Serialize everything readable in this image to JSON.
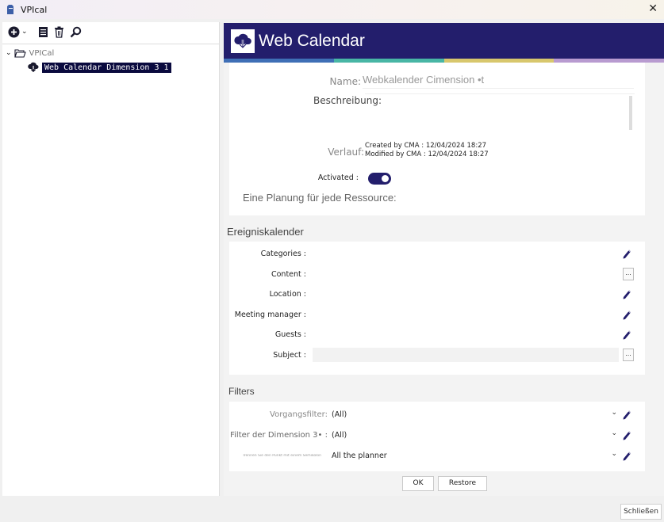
{
  "window": {
    "title": "VPIcal",
    "close_glyph": "✕"
  },
  "toolbar": {
    "add_chevron": "⌄"
  },
  "tree": {
    "root_label": "VPICal",
    "child_label": "Web Calendar Dimension 3 1",
    "root_expander": "⌄"
  },
  "header": {
    "title": "Web Calendar",
    "stripe_colors": [
      "#3f6fb6",
      "#48b6a5",
      "#d8c76d",
      "#b89bd0"
    ]
  },
  "general": {
    "name_label": "Name:",
    "name_value": "Webkalender Cimension •t",
    "description_label": "Beschreibung:",
    "history_label": "Verlauf:",
    "created": "Created by CMA : 12/04/2024 18:27",
    "modified": "Modified by  CMA : 12/04/2024 18:27",
    "activated_label": "Activated :",
    "planning_label": "Eine Planung für jede Ressource:"
  },
  "events": {
    "section_title": "Ereigniskalender",
    "rows": [
      {
        "label": "Categories :",
        "action": "edit"
      },
      {
        "label": "Content :",
        "action": "dots"
      },
      {
        "label": "Location :",
        "action": "edit"
      },
      {
        "label": "Meeting manager :",
        "action": "edit"
      },
      {
        "label": "Guests :",
        "action": "edit"
      },
      {
        "label": "Subject :",
        "action": "dots"
      }
    ],
    "dots_glyph": "..."
  },
  "filters": {
    "section_title": "Filters",
    "rows": [
      {
        "label": "Vorgangsfilter:",
        "value": "(All)"
      },
      {
        "label": "Filter der Dimension 3• :",
        "value": "(All)"
      },
      {
        "label": "Trennen Sie den Punkt mit einem Semikolon",
        "value": "All the planner"
      }
    ],
    "chevron": "⌄"
  },
  "buttons": {
    "ok": "OK",
    "restore": "Restore",
    "close": "Schließen"
  }
}
